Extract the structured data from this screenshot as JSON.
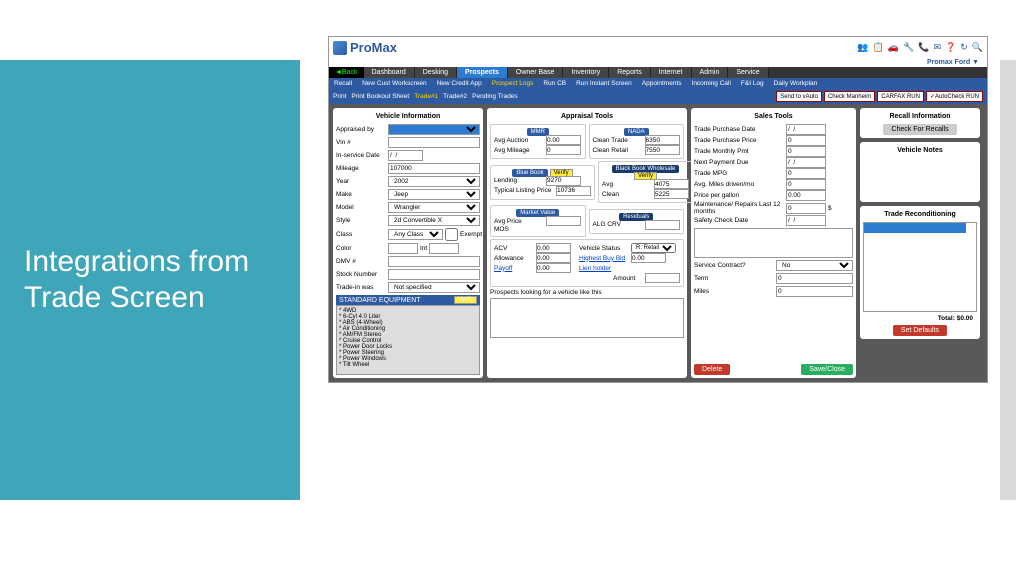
{
  "slide_title": "Integrations from Trade Screen",
  "logo": "ProMax",
  "dealer": "Promax Ford ▼",
  "header_icons": [
    "👥",
    "📋",
    "🚗",
    "🔧",
    "📞",
    "✉",
    "❓",
    "↻",
    "🔍"
  ],
  "nav": {
    "back": "◄Back",
    "tabs": [
      "Dashboard",
      "Desking",
      "Prospects",
      "Owner Base",
      "Inventory",
      "Reports",
      "Internet",
      "Admin",
      "Service"
    ],
    "active": 2
  },
  "subnav": [
    "Recall",
    "New Cust Workscreen",
    "New Credit App",
    "Prospect Logs",
    "Run CB",
    "Run Instant Screen",
    "Appointments",
    "Incoming Call",
    "F&I Log",
    "Daily Workplan"
  ],
  "subnav_hl": 3,
  "toolbar": {
    "links": [
      "Print",
      "Print Bookout Sheet",
      "Trade#1",
      "Trade#2",
      "Pending Trades"
    ],
    "buttons": [
      {
        "t": "Send to vAuto"
      },
      {
        "t": "Check Manheim"
      },
      {
        "t": "CARFAX RUN"
      },
      {
        "t": "✓AutoCheck RUN"
      }
    ]
  },
  "vehicle": {
    "title": "Vehicle Information",
    "appraised_by": "Appraised by",
    "vin": "Vin #",
    "inservice": "In-service Date",
    "inservice_v": "/  /",
    "mileage": "Mileage",
    "mileage_v": "107000",
    "year": "Year",
    "year_v": "2002",
    "make": "Make",
    "make_v": "Jeep",
    "model": "Model",
    "model_v": "Wrangler",
    "style": "Style",
    "style_v": "2d Convertible X",
    "class": "Class",
    "class_v": "Any Class",
    "exempt": "Exempt",
    "color": "Color",
    "int": "Int",
    "dmv": "DMV #",
    "stock": "Stock Number",
    "tradein": "Trade-in was",
    "tradein_v": "Not specified",
    "equip_hdr": "STANDARD EQUIPMENT",
    "verify": "Verify",
    "equip": [
      "* 4WD",
      "* 6-Cyl 4.0 Liter",
      "* ABS (4-Wheel)",
      "* Air Conditioning",
      "* AM/FM Stereo",
      "* Cruise Control",
      "* Power Door Locks",
      "* Power Steering",
      "* Power Windows",
      "* Tilt Wheel"
    ]
  },
  "appraisal": {
    "title": "Appraisal Tools",
    "mmr": "MMR",
    "nada": "NADA",
    "avg_auction": "Avg Auction",
    "avg_auction_v": "0.00",
    "avg_mileage": "Avg Mileage",
    "avg_mileage_v": "0",
    "clean_trade": "Clean Trade",
    "clean_trade_v": "6350",
    "clean_retail": "Clean Retail",
    "clean_retail_v": "7550",
    "bb": "Blue Book",
    "bbw": "Black Book Wholesale",
    "verify": "Verify",
    "lending": "Lending",
    "lending_v": "9270",
    "typical": "Typical Listing Price",
    "typical_v": "10736",
    "avg": "Avg",
    "avg_v": "4075",
    "clean": "Clean",
    "clean_v": "5225",
    "mv": "Market Value",
    "res": "Residuals",
    "avg_price": "Avg Price",
    "alg": "ALG CRV",
    "mos": "MOS",
    "acv": "ACV",
    "acv_v": "0.00",
    "vstatus": "Vehicle Status",
    "vstatus_v": "R: Retail",
    "allowance": "Allowance",
    "allowance_v": "0.00",
    "hbb": "Highest Buy Bid",
    "hbb_v": "0.00",
    "payoff": "Payoff",
    "payoff_v": "0.00",
    "lien": "Lien holder",
    "amount": "Amount",
    "prospects": "Prospects looking for a vehicle like this"
  },
  "sales": {
    "title": "Sales Tools",
    "rows": [
      {
        "l": "Trade Purchase Date",
        "v": "/  /"
      },
      {
        "l": "Trade Purchase Price",
        "v": "0"
      },
      {
        "l": "Trade Monthly Pmt",
        "v": "0"
      },
      {
        "l": "Next Payment Due",
        "v": "/  /"
      },
      {
        "l": "Trade MPG",
        "v": "0"
      },
      {
        "l": "Avg. Miles driven/mo",
        "v": "0"
      },
      {
        "l": "Price per gallon",
        "v": "0.00"
      },
      {
        "l": "Maintenance/ Repairs Last 12 months",
        "v": "0",
        "suffix": "$"
      },
      {
        "l": "Safety Check Date",
        "v": "/  /"
      }
    ],
    "sc": "Service Contract?",
    "sc_v": "No",
    "term": "Term",
    "term_v": "0",
    "miles": "Miles",
    "miles_v": "0",
    "delete": "Delete",
    "save": "Save/Close"
  },
  "right": {
    "recall_t": "Recall Information",
    "recall_btn": "Check For Recalls",
    "notes_t": "Vehicle Notes",
    "recon_t": "Trade Reconditioning",
    "total": "Total:",
    "total_v": "$0.00",
    "defaults": "Set Defaults"
  }
}
